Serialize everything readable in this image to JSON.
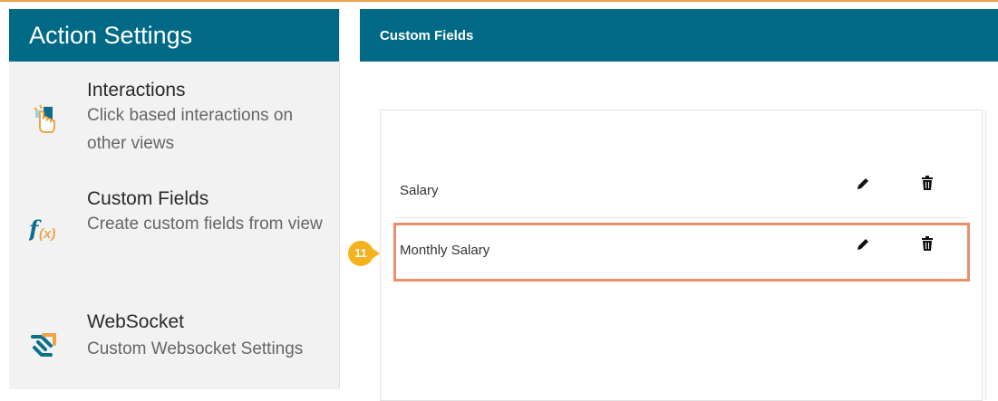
{
  "colors": {
    "header_bg": "#006a86",
    "sidebar_bg": "#f2f2f2",
    "highlight": "#ee8d6a",
    "badge": "#f5b21c"
  },
  "sidebar": {
    "title": "Action Settings",
    "items": [
      {
        "icon": "hand-pointer-icon",
        "title": "Interactions",
        "description": "Click based interactions on other views"
      },
      {
        "icon": "function-icon",
        "title": "Custom Fields",
        "description": "Create custom fields from view"
      },
      {
        "icon": "websocket-icon",
        "title": "WebSocket",
        "description": "Custom Websocket Settings"
      }
    ]
  },
  "panel": {
    "title": "Custom Fields",
    "fields": [
      {
        "name": "Salary",
        "edit_icon": "pencil-icon",
        "delete_icon": "trash-icon"
      },
      {
        "name": "Monthly Salary",
        "edit_icon": "pencil-icon",
        "delete_icon": "trash-icon"
      }
    ]
  },
  "callout": {
    "number": "11"
  }
}
